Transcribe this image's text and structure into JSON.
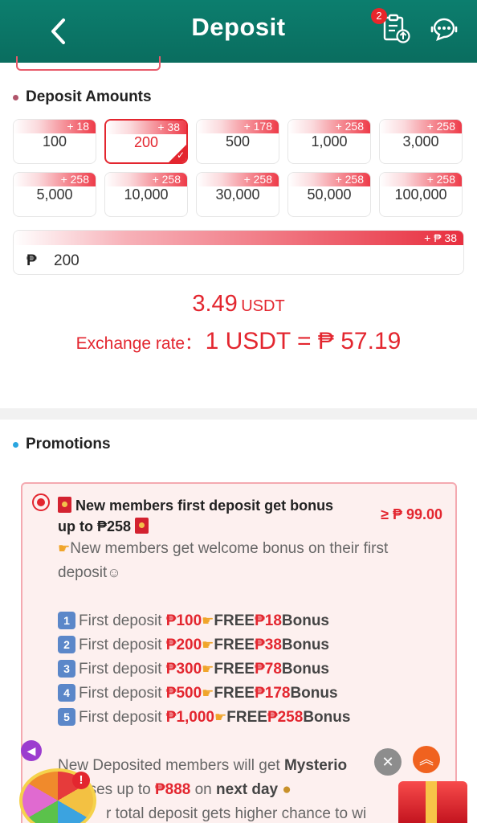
{
  "header": {
    "title": "Deposit",
    "badge_count": "2"
  },
  "deposit_amounts": {
    "title": "Deposit Amounts",
    "options": [
      {
        "bonus": "+ 18",
        "amount": "100",
        "selected": false
      },
      {
        "bonus": "+ 38",
        "amount": "200",
        "selected": true
      },
      {
        "bonus": "+ 178",
        "amount": "500",
        "selected": false
      },
      {
        "bonus": "+ 258",
        "amount": "1,000",
        "selected": false
      },
      {
        "bonus": "+ 258",
        "amount": "3,000",
        "selected": false
      },
      {
        "bonus": "+ 258",
        "amount": "5,000",
        "selected": false
      },
      {
        "bonus": "+ 258",
        "amount": "10,000",
        "selected": false
      },
      {
        "bonus": "+ 258",
        "amount": "30,000",
        "selected": false
      },
      {
        "bonus": "+ 258",
        "amount": "50,000",
        "selected": false
      },
      {
        "bonus": "+ 258",
        "amount": "100,000",
        "selected": false
      }
    ],
    "custom_bonus": "+ ₱ 38",
    "currency_symbol": "₱",
    "custom_value": "200"
  },
  "conversion": {
    "usdt_amount": "3.49",
    "usdt_unit": "USDT",
    "rate_label": "Exchange rate：",
    "rate_value": "1 USDT = ₱ 57.19"
  },
  "promotions": {
    "title": "Promotions",
    "item": {
      "title_line1": "New members first deposit get bonus",
      "title_line2": "up to ₱258",
      "min_deposit": "≥ ₱ 99.00",
      "intro_line1": "New members get welcome bonus on their first",
      "intro_line2": "deposit",
      "tiers": [
        {
          "num": "1",
          "label": "First deposit ",
          "amount": "₱100",
          "free": "FREE",
          "bonus": "₱18",
          "suffix": "Bonus"
        },
        {
          "num": "2",
          "label": "First deposit ",
          "amount": "₱200",
          "free": "FREE",
          "bonus": "₱38",
          "suffix": "Bonus"
        },
        {
          "num": "3",
          "label": "First deposit ",
          "amount": "₱300",
          "free": "FREE",
          "bonus": "₱78",
          "suffix": "Bonus"
        },
        {
          "num": "4",
          "label": "First deposit ",
          "amount": "₱500",
          "free": "FREE",
          "bonus": "₱178",
          "suffix": "Bonus"
        },
        {
          "num": "5",
          "label": "First deposit ",
          "amount": "₱1,000",
          "free": "FREE",
          "bonus": "₱258",
          "suffix": "Bonus"
        }
      ],
      "mystery_pre": "New Deposited members will get ",
      "mystery_bold": "Mysterio",
      "bonus_line_pre": "uses up to ",
      "bonus_line_amt": "₱888",
      "bonus_line_mid": " on ",
      "bonus_line_bold": "next day",
      "last_line": "r total deposit gets higher chance to wi"
    }
  },
  "colors": {
    "header": "#0a6d5f",
    "accent_red": "#e3262f",
    "promo_bg": "#fdf0ef"
  }
}
